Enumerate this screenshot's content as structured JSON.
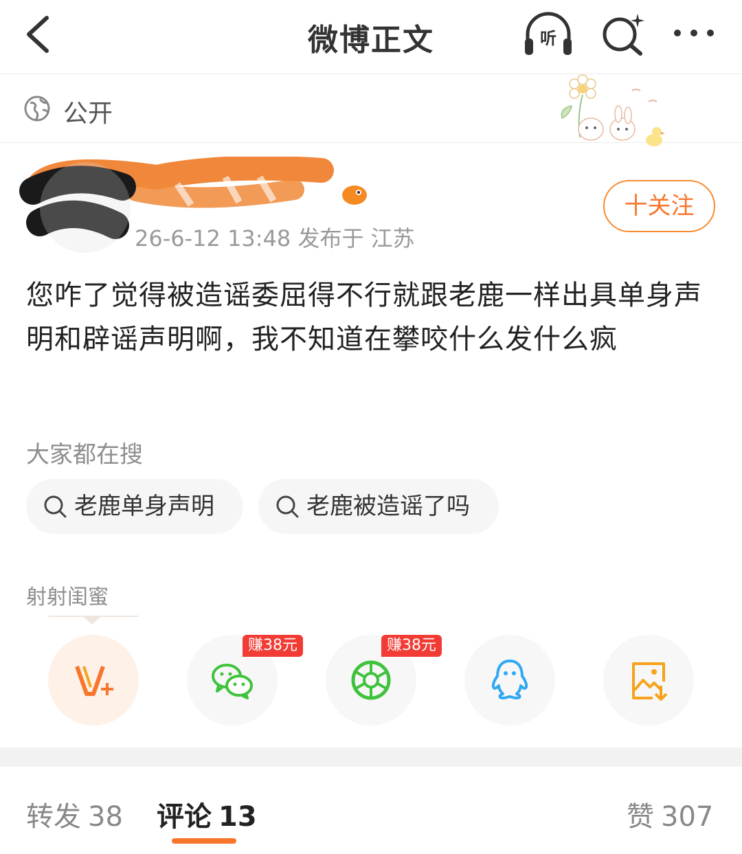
{
  "nav": {
    "title": "微博正文",
    "listen_label": "听"
  },
  "visibility": {
    "label": "公开"
  },
  "post": {
    "meta": "26-6-12 13:48  发布于 江苏",
    "follow_label": "十关注",
    "text": "您咋了觉得被造谣委屈得不行就跟老鹿一样出具单身声明和辟谣声明啊，我不知道在攀咬什么发什么疯"
  },
  "search": {
    "heading": "大家都在搜",
    "chips": [
      "老鹿单身声明",
      "老鹿被造谣了吗"
    ]
  },
  "share": {
    "heading": "射射闺蜜",
    "targets": [
      {
        "icon": "vplus-icon",
        "badge": ""
      },
      {
        "icon": "wechat-icon",
        "badge": "赚38元"
      },
      {
        "icon": "moments-icon",
        "badge": "赚38元"
      },
      {
        "icon": "qq-icon",
        "badge": ""
      },
      {
        "icon": "save-image-icon",
        "badge": ""
      }
    ]
  },
  "tabs": {
    "repost_label": "转发",
    "repost_count": "38",
    "comment_label": "评论",
    "comment_count": "13",
    "like_label": "赞",
    "like_count": "307"
  },
  "colors": {
    "accent": "#f7762c",
    "badge": "#f23b34",
    "wechat": "#3fc23c",
    "moments": "#3fc23c",
    "qq": "#31a8f2",
    "save": "#f7a21b"
  }
}
